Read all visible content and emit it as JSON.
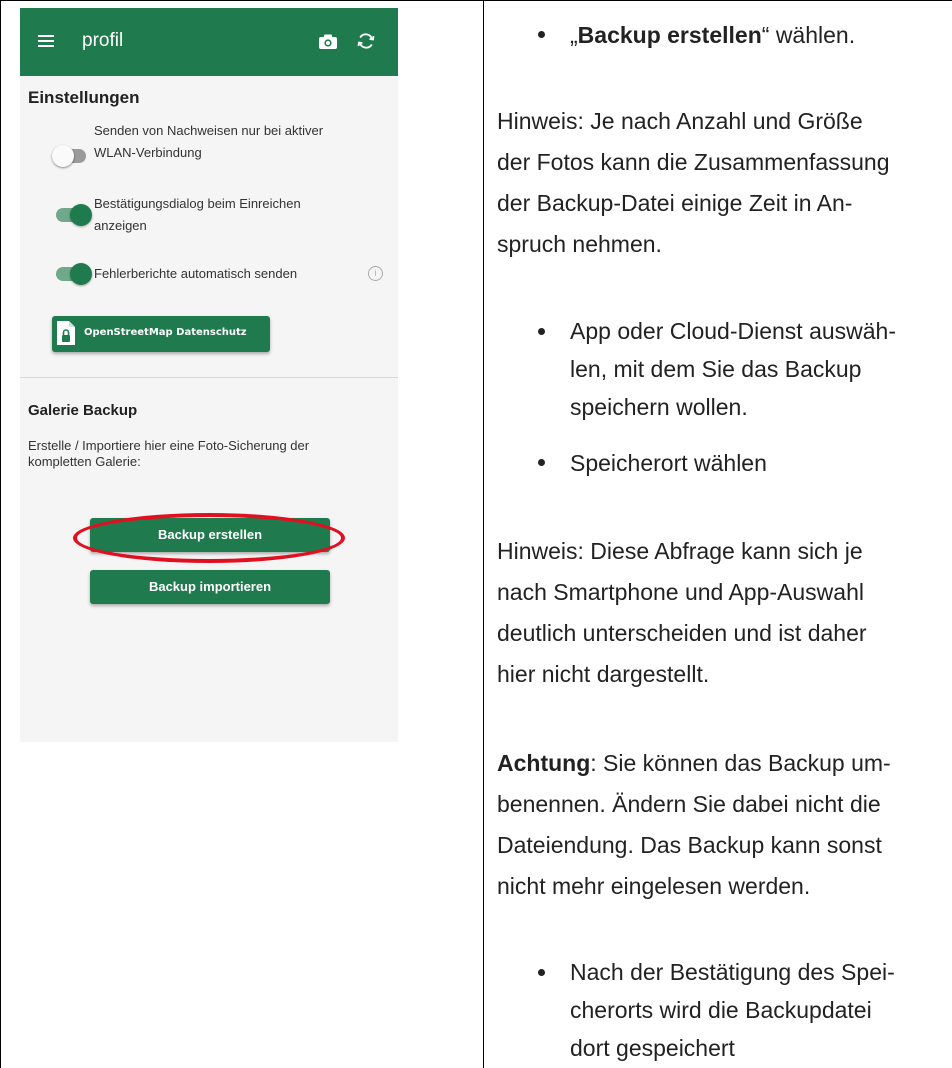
{
  "phone": {
    "appbar": {
      "title": "profil",
      "icons": [
        "menu-icon",
        "camera-icon",
        "sync-icon"
      ]
    },
    "settings": {
      "heading": "Einstellungen",
      "prefs": [
        {
          "line1": "Senden von Nachweisen nur bei aktiver",
          "line2": "WLAN-Verbindung",
          "enabled": false
        },
        {
          "line1": "Bestätigungsdialog beim Einreichen",
          "line2": "anzeigen",
          "enabled": true
        },
        {
          "line1": "Fehlerberichte automatisch senden",
          "line2": "",
          "enabled": true
        }
      ],
      "osm_button": "OpenStreetMap Datenschutz"
    },
    "gallery": {
      "heading": "Galerie Backup",
      "description_1": "Erstelle / Importiere hier eine Foto-Sicherung der",
      "description_2": "kompletten Galerie:",
      "create_button": "Backup erstellen",
      "import_button": "Backup importieren"
    },
    "colors": {
      "primary": "#1f7a4d",
      "highlight": "#e01020"
    }
  },
  "instructions": {
    "step1": {
      "prefix": "„",
      "bold": "Backup erstellen",
      "suffix": "“ wählen."
    },
    "note1": [
      "Hinweis: Je nach Anzahl und Größe",
      "der Fotos kann die Zusammenfassung",
      "der Backup-Datei einige Zeit in An-",
      "spruch nehmen."
    ],
    "step2": [
      "App oder Cloud-Dienst auswäh-",
      "len, mit dem Sie das Backup",
      "speichern wollen."
    ],
    "step3": "Speicherort wählen",
    "note2": [
      "Hinweis: Diese Abfrage kann sich je",
      "nach Smartphone und App-Auswahl",
      "deutlich unterscheiden und ist daher",
      "hier nicht dargestellt."
    ],
    "warning": {
      "bold": "Achtung",
      "line1_rest": ": Sie können das Backup um-",
      "lines": [
        "benennen. Ändern Sie dabei nicht die",
        "Dateiendung. Das Backup kann sonst",
        "nicht mehr eingelesen werden."
      ]
    },
    "step4": [
      "Nach der Bestätigung des Spei-",
      "cherorts wird die Backupdatei",
      "dort gespeichert"
    ]
  }
}
